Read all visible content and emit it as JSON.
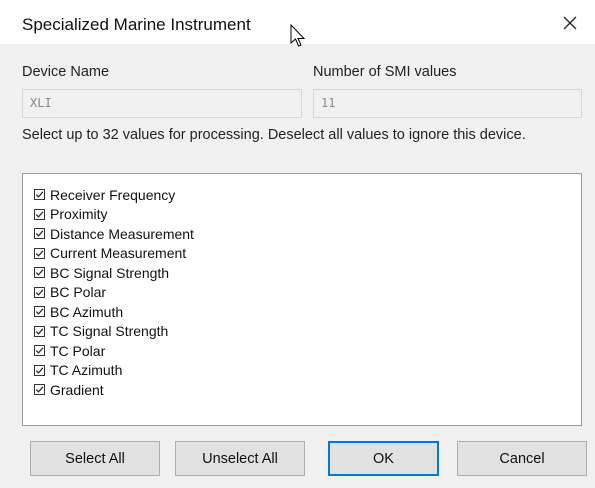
{
  "window": {
    "title": "Specialized Marine Instrument",
    "close_icon": "close-icon"
  },
  "device_name": {
    "label": "Device Name",
    "value": "XLI"
  },
  "smi_count": {
    "label": "Number of SMI values",
    "value": "11"
  },
  "instructions": "Select up to 32 values for processing. Deselect all values to ignore this device.",
  "values": [
    {
      "label": "Receiver Frequency",
      "checked": true
    },
    {
      "label": "Proximity",
      "checked": true
    },
    {
      "label": "Distance Measurement",
      "checked": true
    },
    {
      "label": "Current Measurement",
      "checked": true
    },
    {
      "label": "BC Signal Strength",
      "checked": true
    },
    {
      "label": "BC Polar",
      "checked": true
    },
    {
      "label": "BC Azimuth",
      "checked": true
    },
    {
      "label": "TC Signal Strength",
      "checked": true
    },
    {
      "label": "TC Polar",
      "checked": true
    },
    {
      "label": "TC Azimuth",
      "checked": true
    },
    {
      "label": "Gradient",
      "checked": true
    }
  ],
  "buttons": {
    "select_all": "Select All",
    "unselect_all": "Unselect All",
    "ok": "OK",
    "cancel": "Cancel"
  },
  "colors": {
    "window_bg": "#f0f0f0",
    "titlebar_bg": "#ffffff",
    "default_button_border": "#0078d7"
  }
}
